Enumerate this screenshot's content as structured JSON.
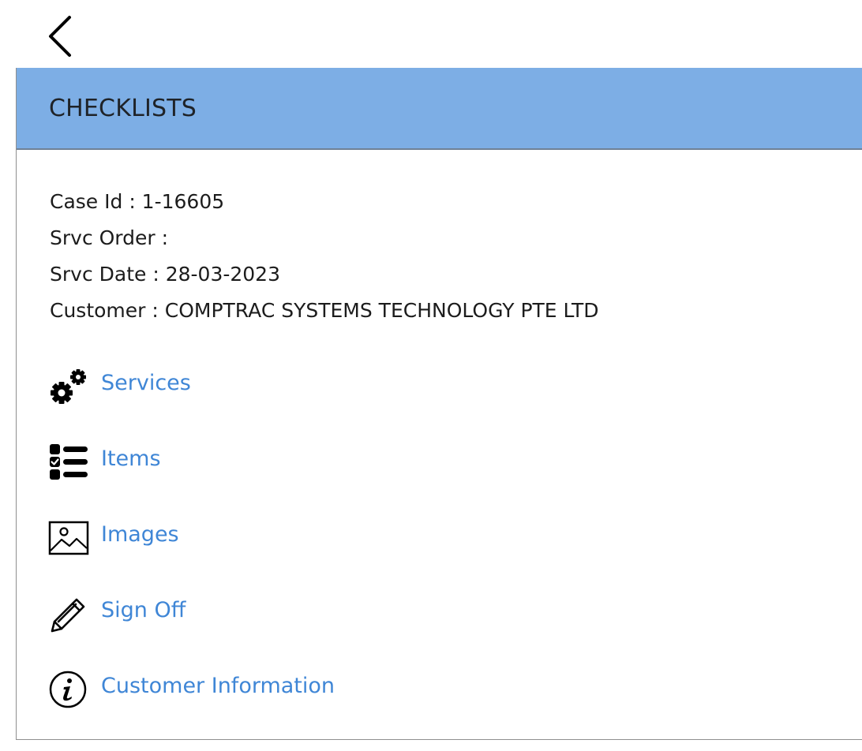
{
  "nav": {
    "back_icon": "chevron-left-icon"
  },
  "header": {
    "title": "CHECKLISTS",
    "background_color": "#7daee5"
  },
  "details": {
    "case_id": "Case Id : 1-16605",
    "srvc_order": "Srvc Order :",
    "srvc_date": "Srvc Date : 28-03-2023",
    "customer": "Customer : COMPTRAC SYSTEMS TECHNOLOGY PTE LTD"
  },
  "menu": {
    "link_color": "#3f86d6",
    "items": [
      {
        "label": "Services",
        "icon": "gears-icon"
      },
      {
        "label": "Items",
        "icon": "checklist-icon"
      },
      {
        "label": "Images",
        "icon": "image-icon"
      },
      {
        "label": "Sign Off",
        "icon": "pencil-icon"
      },
      {
        "label": "Customer Information",
        "icon": "info-circle-icon"
      }
    ]
  }
}
